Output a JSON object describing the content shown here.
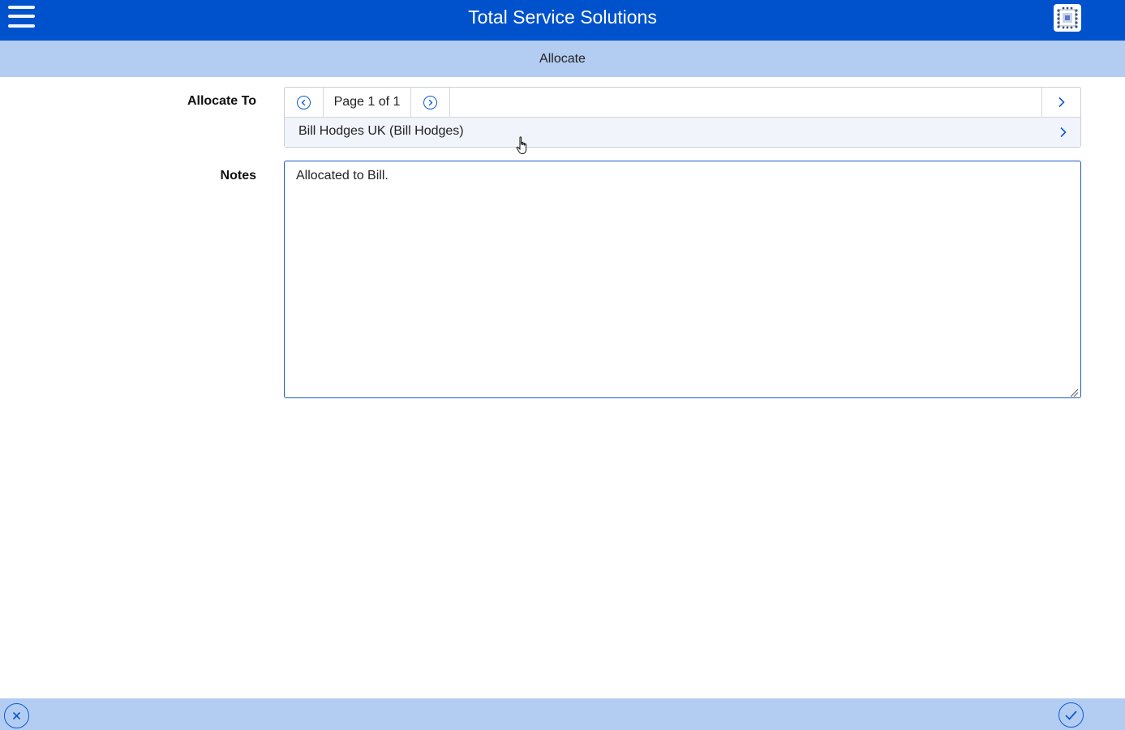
{
  "header": {
    "title": "Total Service Solutions",
    "menu_icon": "hamburger-menu-icon",
    "logo_icon": "app-logo-icon",
    "color": "#0052cc"
  },
  "subheader": {
    "title": "Allocate",
    "color": "#b3cdf2"
  },
  "form": {
    "allocate_to": {
      "label": "Allocate To",
      "pager_text": "Page 1 of 1",
      "prev_icon": "circle-chevron-left-icon",
      "next_icon": "circle-chevron-right-icon",
      "open_icon": "chevron-right-icon",
      "results": [
        {
          "text": "Bill Hodges UK (Bill Hodges)"
        }
      ]
    },
    "notes": {
      "label": "Notes",
      "value": "Allocated to Bill."
    }
  },
  "footer": {
    "cancel_icon": "circle-close-icon",
    "confirm_icon": "circle-check-icon",
    "accent": "#0b5bd3"
  }
}
